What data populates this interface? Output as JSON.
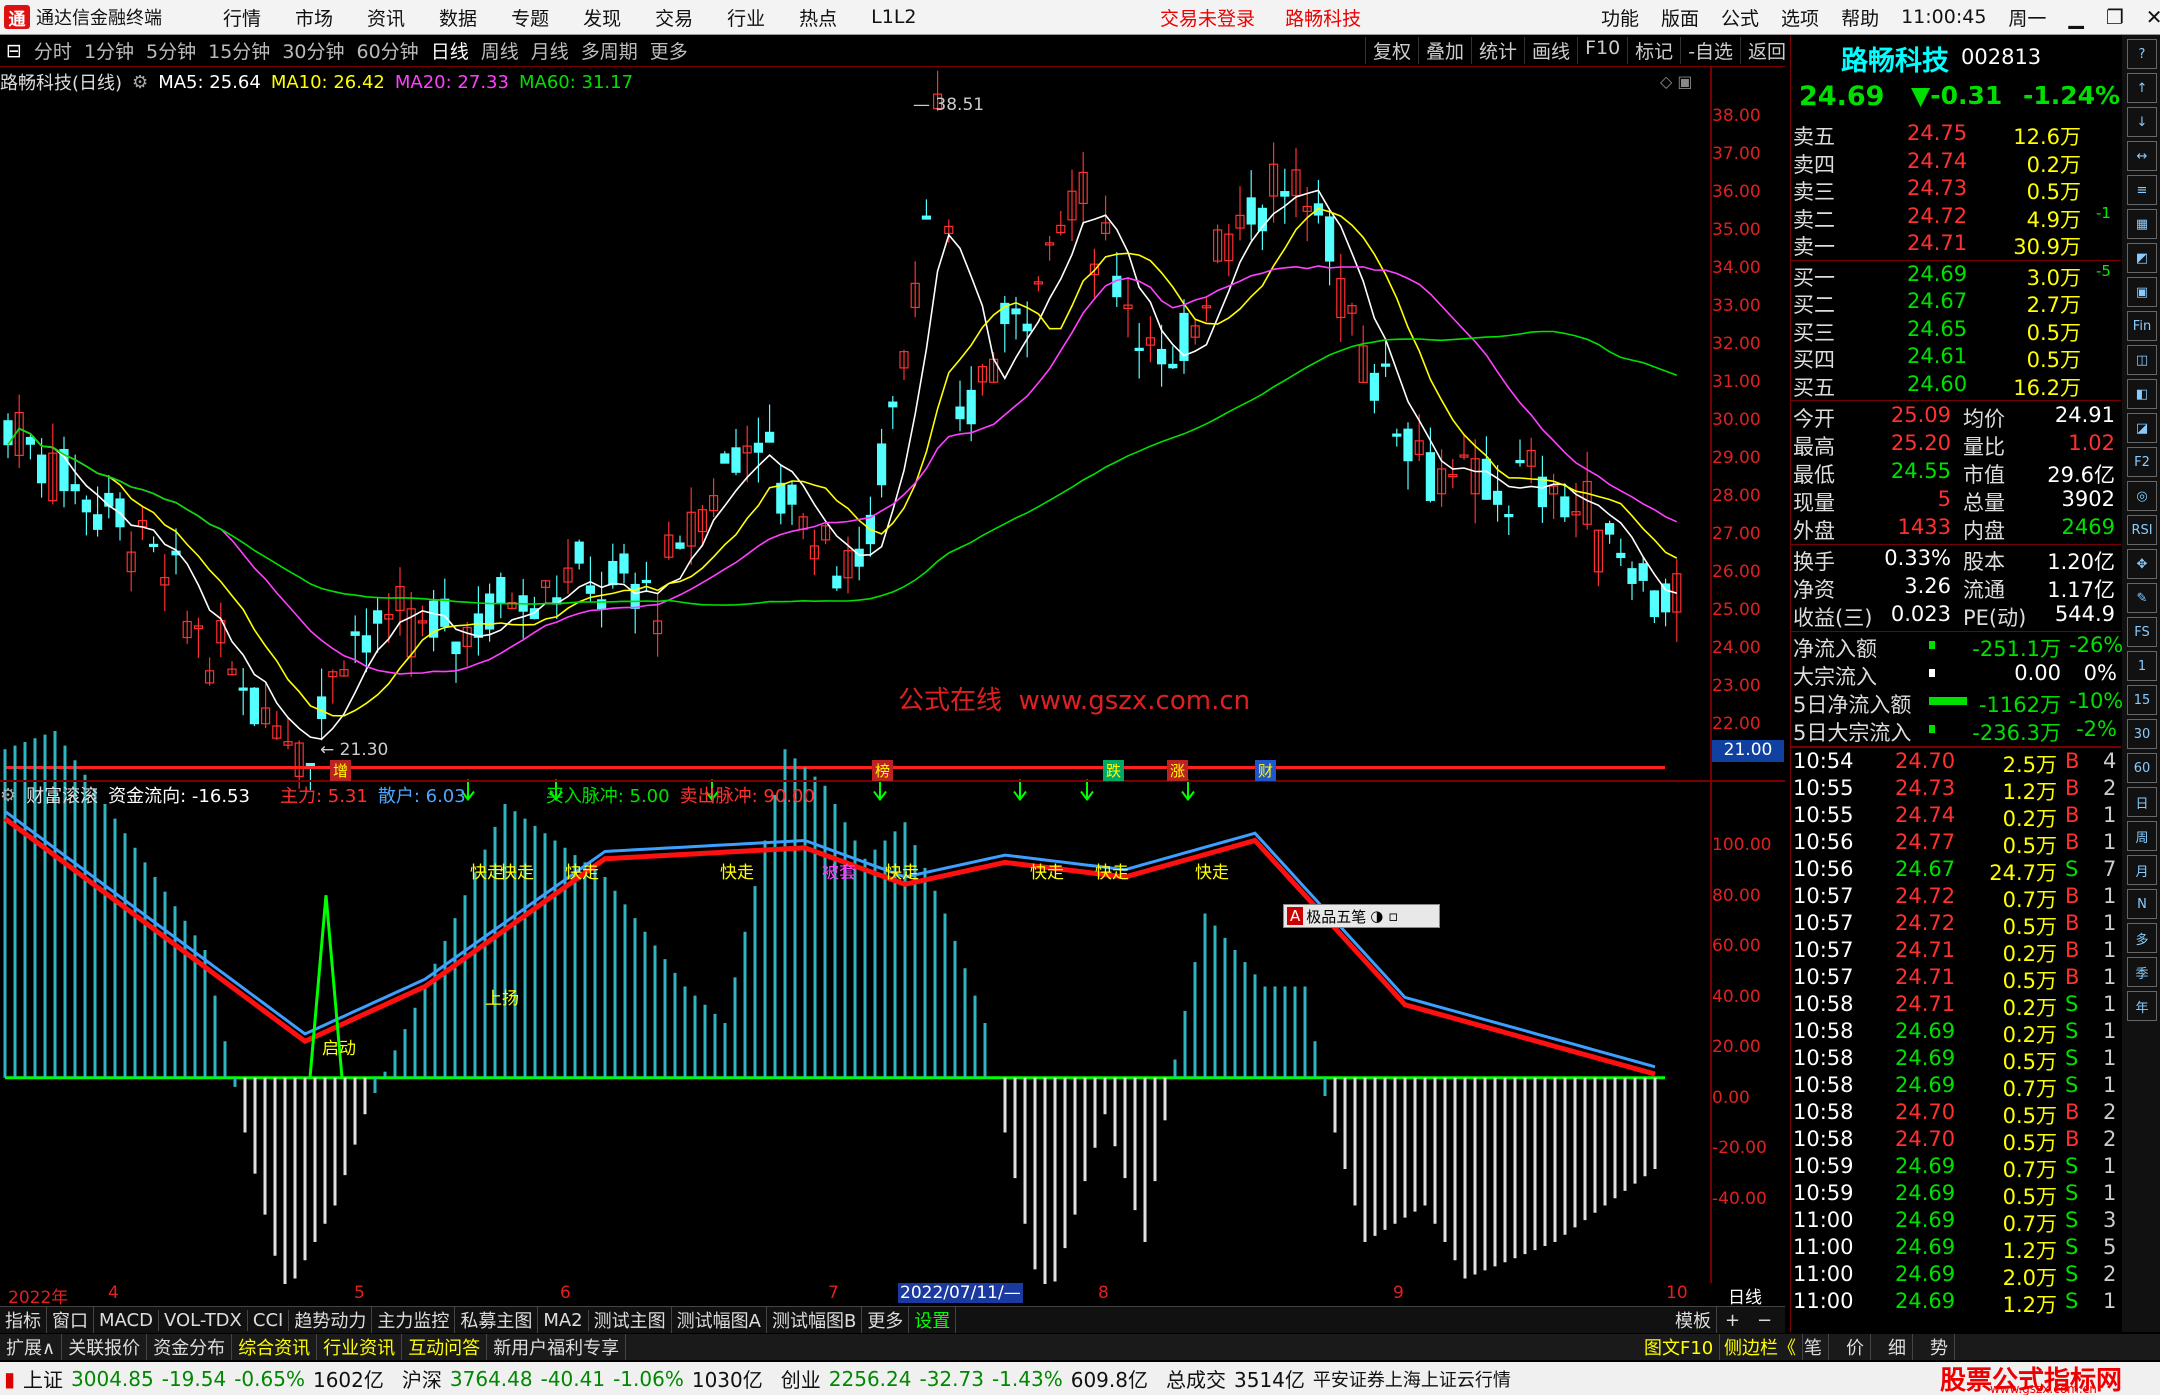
{
  "titlebar": {
    "logo_glyph": "通",
    "app_name": "通达信金融终端",
    "menu": [
      "行情",
      "市场",
      "资讯",
      "数据",
      "专题",
      "发现",
      "交易",
      "行业",
      "热点",
      "L1L2"
    ],
    "notice": [
      "交易未登录",
      "路畅科技"
    ],
    "right_menu": [
      "功能",
      "版面",
      "公式",
      "选项",
      "帮助"
    ],
    "time": "11:00:45",
    "weekday": "周一"
  },
  "toolbar": {
    "periods": [
      "分时",
      "1分钟",
      "5分钟",
      "15分钟",
      "30分钟",
      "60分钟",
      "日线",
      "周线",
      "月线",
      "多周期",
      "更多"
    ],
    "active_period": "日线",
    "right": [
      "复权",
      "叠加",
      "统计",
      "画线",
      "F10",
      "标记",
      "-自选",
      "返回"
    ]
  },
  "main_chart": {
    "stock_label": "路畅科技(日线)",
    "ma": [
      {
        "name": "MA5: 25.64",
        "color": "#ffffff"
      },
      {
        "name": "MA10: 26.42",
        "color": "#ffff00"
      },
      {
        "name": "MA20: 27.33",
        "color": "#ff40ff"
      },
      {
        "name": "MA60: 31.17",
        "color": "#00e000"
      }
    ],
    "y_ticks": [
      "38.00",
      "37.00",
      "36.00",
      "35.00",
      "34.00",
      "33.00",
      "32.00",
      "31.00",
      "30.00",
      "29.00",
      "28.00",
      "27.00",
      "26.00",
      "25.00",
      "24.00",
      "23.00",
      "22.00"
    ],
    "y_current": "21.00",
    "high_label": "38.51",
    "low_label": "21.30",
    "watermark": "公式在线  www.gszx.com.cn",
    "event_tags": [
      "增",
      "榜",
      "跌",
      "涨",
      "财"
    ]
  },
  "indicator": {
    "name": "财富滚滚",
    "fields": [
      {
        "text": "资金流向: -16.53",
        "color": "#ffffff"
      },
      {
        "text": "主力: 5.31",
        "color": "#ff3030"
      },
      {
        "text": "散户: 6.03",
        "color": "#4da6ff"
      },
      {
        "text": "买入脉冲: 5.00",
        "color": "#00e000"
      },
      {
        "text": "卖出脉冲: 90.00",
        "color": "#ff3030"
      }
    ],
    "y_ticks": [
      "100.00",
      "80.00",
      "60.00",
      "40.00",
      "20.00",
      "0.00",
      "-20.00",
      "-40.00"
    ],
    "labels": [
      "快走",
      "快走",
      "快走",
      "快走",
      "快走",
      "快走",
      "快走",
      "快走",
      "被套",
      "启动",
      "上扬"
    ],
    "popup": "极品五笔"
  },
  "date_axis": {
    "labels": [
      "2022年",
      "4",
      "5",
      "6",
      "7",
      "2022/07/11/—",
      "8",
      "9",
      "10"
    ],
    "right": "日线"
  },
  "bottom_tabs": {
    "row1": [
      "指标",
      "窗口",
      "MACD",
      "VOL-TDX",
      "CCI",
      "趋势动力",
      "主力监控",
      "私募主图",
      "MA2",
      "测试主图",
      "测试幅图A",
      "测试幅图B",
      "更多",
      "设置"
    ],
    "row1_right": [
      "模板",
      "+",
      "−"
    ],
    "row2": [
      "扩展∧",
      "关联报价",
      "资金分布",
      "综合资讯",
      "行业资讯",
      "互动问答",
      "新用户福利专享"
    ],
    "row2_right": [
      "图文F10",
      "侧边栏《",
      "笔",
      "价",
      "细",
      "势"
    ]
  },
  "status": {
    "items": [
      {
        "name": "上证",
        "price": "3004.85",
        "chg": "-19.54",
        "pct": "-0.65%",
        "amt": "1602亿"
      },
      {
        "name": "沪深",
        "price": "3764.48",
        "chg": "-40.41",
        "pct": "-1.06%",
        "amt": "1030亿"
      },
      {
        "name": "创业",
        "price": "2256.24",
        "chg": "-32.73",
        "pct": "-1.43%",
        "amt": "609.8亿"
      }
    ],
    "total_label": "总成交",
    "total": "3514亿",
    "broker": "平安证券上海上证云行情",
    "brand": "股票公式指标网",
    "brand_url": "www.gszx.com.cn"
  },
  "quote": {
    "name": "路畅科技",
    "code": "002813",
    "price": "24.69",
    "change": "▼-0.31",
    "pct": "-1.24%",
    "asks": [
      {
        "l": "卖五",
        "p": "24.75",
        "v": "12.6万",
        "x": ""
      },
      {
        "l": "卖四",
        "p": "24.74",
        "v": "0.2万",
        "x": ""
      },
      {
        "l": "卖三",
        "p": "24.73",
        "v": "0.5万",
        "x": ""
      },
      {
        "l": "卖二",
        "p": "24.72",
        "v": "4.9万",
        "x": "-1"
      },
      {
        "l": "卖一",
        "p": "24.71",
        "v": "30.9万",
        "x": ""
      }
    ],
    "bids": [
      {
        "l": "买一",
        "p": "24.69",
        "v": "3.0万",
        "x": "-5"
      },
      {
        "l": "买二",
        "p": "24.67",
        "v": "2.7万",
        "x": ""
      },
      {
        "l": "买三",
        "p": "24.65",
        "v": "0.5万",
        "x": ""
      },
      {
        "l": "买四",
        "p": "24.61",
        "v": "0.5万",
        "x": ""
      },
      {
        "l": "买五",
        "p": "24.60",
        "v": "16.2万",
        "x": ""
      }
    ],
    "stats": [
      {
        "a": "今开",
        "av": "25.09",
        "ac": "red",
        "b": "均价",
        "bv": "24.91",
        "bc": "wht"
      },
      {
        "a": "最高",
        "av": "25.20",
        "ac": "red",
        "b": "量比",
        "bv": "1.02",
        "bc": "red"
      },
      {
        "a": "最低",
        "av": "24.55",
        "ac": "grn",
        "b": "市值",
        "bv": "29.6亿",
        "bc": "wht"
      },
      {
        "a": "现量",
        "av": "5",
        "ac": "red",
        "b": "总量",
        "bv": "3902",
        "bc": "wht"
      },
      {
        "a": "外盘",
        "av": "1433",
        "ac": "red",
        "b": "内盘",
        "bv": "2469",
        "bc": "grn"
      },
      {
        "a": "换手",
        "av": "0.33%",
        "ac": "wht",
        "b": "股本",
        "bv": "1.20亿",
        "bc": "wht"
      },
      {
        "a": "净资",
        "av": "3.26",
        "ac": "wht",
        "b": "流通",
        "bv": "1.17亿",
        "bc": "wht"
      },
      {
        "a": "收益(三)",
        "av": "0.023",
        "ac": "wht",
        "b": "PE(动)",
        "bv": "544.9",
        "bc": "wht"
      }
    ],
    "flows": [
      {
        "l": "净流入额",
        "v": "-251.1万",
        "p": "-26%",
        "c": "grn"
      },
      {
        "l": "大宗流入",
        "v": "0.00",
        "p": "0%",
        "c": "wht"
      },
      {
        "l": "5日净流入额",
        "v": "-1162万",
        "p": "-10%",
        "c": "grn"
      },
      {
        "l": "5日大宗流入",
        "v": "-236.3万",
        "p": "-2%",
        "c": "grn"
      }
    ],
    "ticks": [
      [
        "10:54",
        "24.70",
        "2.5万",
        "B",
        "4"
      ],
      [
        "10:55",
        "24.73",
        "1.2万",
        "B",
        "2"
      ],
      [
        "10:55",
        "24.74",
        "0.2万",
        "B",
        "1"
      ],
      [
        "10:56",
        "24.77",
        "0.5万",
        "B",
        "1"
      ],
      [
        "10:56",
        "24.67",
        "24.7万",
        "S",
        "7"
      ],
      [
        "10:57",
        "24.72",
        "0.7万",
        "B",
        "1"
      ],
      [
        "10:57",
        "24.72",
        "0.5万",
        "B",
        "1"
      ],
      [
        "10:57",
        "24.71",
        "0.2万",
        "B",
        "1"
      ],
      [
        "10:57",
        "24.71",
        "0.5万",
        "B",
        "1"
      ],
      [
        "10:58",
        "24.71",
        "0.2万",
        "S",
        "1"
      ],
      [
        "10:58",
        "24.69",
        "0.2万",
        "S",
        "1"
      ],
      [
        "10:58",
        "24.69",
        "0.5万",
        "S",
        "1"
      ],
      [
        "10:58",
        "24.69",
        "0.7万",
        "S",
        "1"
      ],
      [
        "10:58",
        "24.70",
        "0.5万",
        "B",
        "2"
      ],
      [
        "10:58",
        "24.70",
        "0.5万",
        "B",
        "2"
      ],
      [
        "10:59",
        "24.69",
        "0.7万",
        "S",
        "1"
      ],
      [
        "10:59",
        "24.69",
        "0.5万",
        "S",
        "1"
      ],
      [
        "11:00",
        "24.69",
        "0.7万",
        "S",
        "3"
      ],
      [
        "11:00",
        "24.69",
        "1.2万",
        "S",
        "5"
      ],
      [
        "11:00",
        "24.69",
        "2.0万",
        "S",
        "2"
      ],
      [
        "11:00",
        "24.69",
        "1.2万",
        "S",
        "1"
      ]
    ]
  },
  "side_icons": [
    "?",
    "↑",
    "↓",
    "↔",
    "≡",
    "▦",
    "◩",
    "▣",
    "Fin",
    "◫",
    "◧",
    "◪",
    "F2",
    "◎",
    "RSI",
    "✥",
    "✎",
    "FS",
    "1",
    "15",
    "30",
    "60",
    "日",
    "周",
    "月",
    "N",
    "多",
    "季",
    "年"
  ]
}
